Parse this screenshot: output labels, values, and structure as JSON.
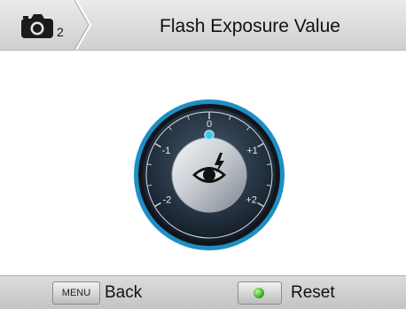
{
  "header": {
    "camera_icon": "camera-icon",
    "camera_index": "2",
    "title": "Flash Exposure Value"
  },
  "dial": {
    "icon": "eye-flash-icon",
    "current_value": 0,
    "ticks": [
      "-2",
      "-1",
      "0",
      "+1",
      "+2"
    ],
    "accent_color": "#1e8fc4",
    "indicator_color": "#3fc6e6"
  },
  "footer": {
    "back": {
      "key_label": "MENU",
      "label": "Back"
    },
    "reset": {
      "key_icon": "ok-button-icon",
      "label": "Reset"
    }
  }
}
